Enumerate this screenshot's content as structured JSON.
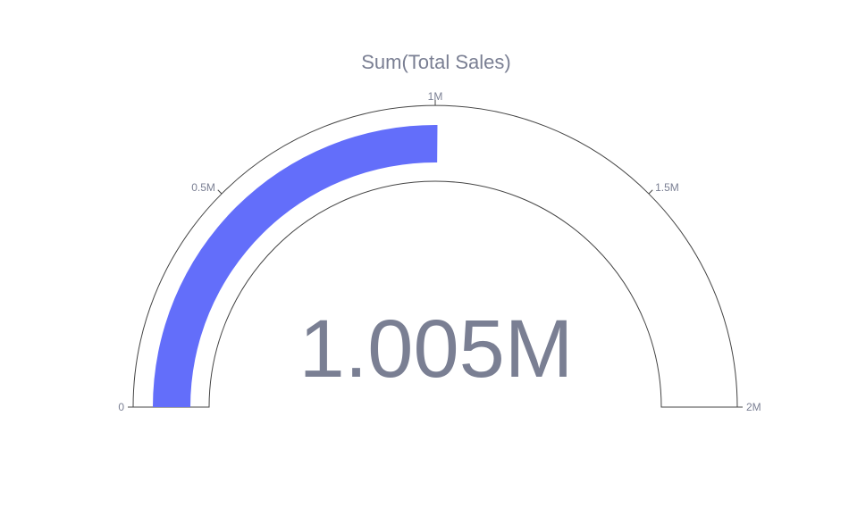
{
  "chart_data": {
    "type": "gauge",
    "title": "Sum(Total Sales)",
    "value": 1005000,
    "value_label": "1.005M",
    "range": [
      0,
      2000000
    ],
    "ticks": [
      {
        "value": 0,
        "label": "0"
      },
      {
        "value": 500000,
        "label": "0.5M"
      },
      {
        "value": 1000000,
        "label": "1M"
      },
      {
        "value": 1500000,
        "label": "1.5M"
      },
      {
        "value": 2000000,
        "label": "2M"
      }
    ],
    "colors": {
      "bar": "#636efa",
      "text": "#7a7f93",
      "outline": "#444444"
    }
  }
}
